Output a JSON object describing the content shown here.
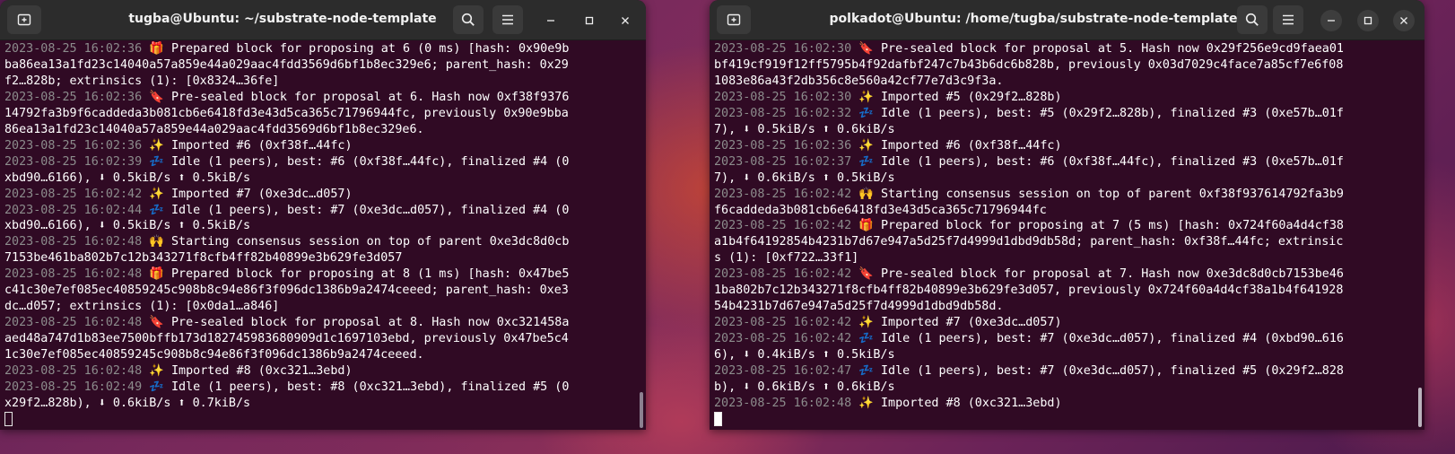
{
  "left_terminal": {
    "title": "tugba@Ubuntu: ~/substrate-node-template",
    "lines": [
      [
        {
          "t": "2023-08-25 16:02:36",
          "c": "ts"
        },
        {
          "t": " 🎁 Prepared block for proposing at 6 (0 ms) [hash: 0x90e9b"
        }
      ],
      [
        {
          "t": "ba86ea13a1fd23c14040a57a859e44a029aac4fdd3569d6bf1b8ec329e6; parent_hash: 0x29"
        }
      ],
      [
        {
          "t": "f2…828b; extrinsics (1): [0x8324…36fe]"
        }
      ],
      [
        {
          "t": "2023-08-25 16:02:36",
          "c": "ts"
        },
        {
          "t": " 🔖 Pre-sealed block for proposal at 6. Hash now 0xf38f9376"
        }
      ],
      [
        {
          "t": "14792fa3b9f6caddeda3b081cb6e6418fd3e43d5ca365c71796944fc, previously 0x90e9bba"
        }
      ],
      [
        {
          "t": "86ea13a1fd23c14040a57a859e44a029aac4fdd3569d6bf1b8ec329e6."
        }
      ],
      [
        {
          "t": "2023-08-25 16:02:36",
          "c": "ts"
        },
        {
          "t": " ✨ Imported #6 (0xf38f…44fc)"
        }
      ],
      [
        {
          "t": "2023-08-25 16:02:39",
          "c": "ts"
        },
        {
          "t": " 💤 Idle (1 peers), best: #6 (0xf38f…44fc), finalized #4 (0"
        }
      ],
      [
        {
          "t": "xbd90…6166), ⬇ 0.5kiB/s ⬆ 0.5kiB/s"
        }
      ],
      [
        {
          "t": "2023-08-25 16:02:42",
          "c": "ts"
        },
        {
          "t": " ✨ Imported #7 (0xe3dc…d057)"
        }
      ],
      [
        {
          "t": "2023-08-25 16:02:44",
          "c": "ts"
        },
        {
          "t": " 💤 Idle (1 peers), best: #7 (0xe3dc…d057), finalized #4 (0"
        }
      ],
      [
        {
          "t": "xbd90…6166), ⬇ 0.5kiB/s ⬆ 0.5kiB/s"
        }
      ],
      [
        {
          "t": "2023-08-25 16:02:48",
          "c": "ts"
        },
        {
          "t": " 🙌 Starting consensus session on top of parent 0xe3dc8d0cb"
        }
      ],
      [
        {
          "t": "7153be461ba802b7c12b343271f8cfb4ff82b40899e3b629fe3d057"
        }
      ],
      [
        {
          "t": "2023-08-25 16:02:48",
          "c": "ts"
        },
        {
          "t": " 🎁 Prepared block for proposing at 8 (1 ms) [hash: 0x47be5"
        }
      ],
      [
        {
          "t": "c41c30e7ef085ec40859245c908b8c94e86f3f096dc1386b9a2474ceeed; parent_hash: 0xe3"
        }
      ],
      [
        {
          "t": "dc…d057; extrinsics (1): [0x0da1…a846]"
        }
      ],
      [
        {
          "t": "2023-08-25 16:02:48",
          "c": "ts"
        },
        {
          "t": " 🔖 Pre-sealed block for proposal at 8. Hash now 0xc321458a"
        }
      ],
      [
        {
          "t": "aed48a747d1b83ee7500bffb173d182745983680909d1c1697103ebd, previously 0x47be5c4"
        }
      ],
      [
        {
          "t": "1c30e7ef085ec40859245c908b8c94e86f3f096dc1386b9a2474ceeed."
        }
      ],
      [
        {
          "t": "2023-08-25 16:02:48",
          "c": "ts"
        },
        {
          "t": " ✨ Imported #8 (0xc321…3ebd)"
        }
      ],
      [
        {
          "t": "2023-08-25 16:02:49",
          "c": "ts"
        },
        {
          "t": " 💤 Idle (1 peers), best: #8 (0xc321…3ebd), finalized #5 (0"
        }
      ],
      [
        {
          "t": "x29f2…828b), ⬇ 0.6kiB/s ⬆ 0.7kiB/s"
        }
      ]
    ]
  },
  "right_terminal": {
    "title": "polkadot@Ubuntu: /home/tugba/substrate-node-template",
    "lines": [
      [
        {
          "t": "2023-08-25 16:02:30",
          "c": "ts"
        },
        {
          "t": " 🔖 Pre-sealed block for proposal at 5. Hash now 0x29f256e9cd9faea01"
        }
      ],
      [
        {
          "t": "bf419cf919f12ff5795b4f92dafbf247c7b43b6dc6b828b, previously 0x03d7029c4face7a85cf7e6f08"
        }
      ],
      [
        {
          "t": "1083e86a43f2db356c8e560a42cf77e7d3c9f3a."
        }
      ],
      [
        {
          "t": "2023-08-25 16:02:30",
          "c": "ts"
        },
        {
          "t": " ✨ Imported #5 (0x29f2…828b)"
        }
      ],
      [
        {
          "t": "2023-08-25 16:02:32",
          "c": "ts"
        },
        {
          "t": " 💤 Idle (1 peers), best: #5 (0x29f2…828b), finalized #3 (0xe57b…01f"
        }
      ],
      [
        {
          "t": "7), ⬇ 0.5kiB/s ⬆ 0.6kiB/s"
        }
      ],
      [
        {
          "t": "2023-08-25 16:02:36",
          "c": "ts"
        },
        {
          "t": " ✨ Imported #6 (0xf38f…44fc)"
        }
      ],
      [
        {
          "t": "2023-08-25 16:02:37",
          "c": "ts"
        },
        {
          "t": " 💤 Idle (1 peers), best: #6 (0xf38f…44fc), finalized #3 (0xe57b…01f"
        }
      ],
      [
        {
          "t": "7), ⬇ 0.6kiB/s ⬆ 0.5kiB/s"
        }
      ],
      [
        {
          "t": "2023-08-25 16:02:42",
          "c": "ts"
        },
        {
          "t": " 🙌 Starting consensus session on top of parent 0xf38f937614792fa3b9"
        }
      ],
      [
        {
          "t": "f6caddeda3b081cb6e6418fd3e43d5ca365c71796944fc"
        }
      ],
      [
        {
          "t": "2023-08-25 16:02:42",
          "c": "ts"
        },
        {
          "t": " 🎁 Prepared block for proposing at 7 (5 ms) [hash: 0x724f60a4d4cf38"
        }
      ],
      [
        {
          "t": "a1b4f64192854b4231b7d67e947a5d25f7d4999d1dbd9db58d; parent_hash: 0xf38f…44fc; extrinsic"
        }
      ],
      [
        {
          "t": "s (1): [0xf722…33f1]"
        }
      ],
      [
        {
          "t": "2023-08-25 16:02:42",
          "c": "ts"
        },
        {
          "t": " 🔖 Pre-sealed block for proposal at 7. Hash now 0xe3dc8d0cb7153be46"
        }
      ],
      [
        {
          "t": "1ba802b7c12b343271f8cfb4ff82b40899e3b629fe3d057, previously 0x724f60a4d4cf38a1b4f641928"
        }
      ],
      [
        {
          "t": "54b4231b7d67e947a5d25f7d4999d1dbd9db58d."
        }
      ],
      [
        {
          "t": "2023-08-25 16:02:42",
          "c": "ts"
        },
        {
          "t": " ✨ Imported #7 (0xe3dc…d057)"
        }
      ],
      [
        {
          "t": "2023-08-25 16:02:42",
          "c": "ts"
        },
        {
          "t": " 💤 Idle (1 peers), best: #7 (0xe3dc…d057), finalized #4 (0xbd90…616"
        }
      ],
      [
        {
          "t": "6), ⬇ 0.4kiB/s ⬆ 0.5kiB/s"
        }
      ],
      [
        {
          "t": "2023-08-25 16:02:47",
          "c": "ts"
        },
        {
          "t": " 💤 Idle (1 peers), best: #7 (0xe3dc…d057), finalized #5 (0x29f2…828"
        }
      ],
      [
        {
          "t": "b), ⬇ 0.6kiB/s ⬆ 0.6kiB/s"
        }
      ],
      [
        {
          "t": "2023-08-25 16:02:48",
          "c": "ts"
        },
        {
          "t": " ✨ Imported #8 (0xc321…3ebd)"
        }
      ]
    ]
  },
  "colors": {
    "terminal_bg": "#300a24",
    "titlebar_bg": "#2c2c2c",
    "timestamp": "#8c8c8c",
    "text": "#ffffff"
  },
  "icons": {
    "new_tab": "new-tab-icon",
    "search": "search-icon",
    "menu": "hamburger-menu-icon",
    "minimize": "minimize-icon",
    "maximize": "maximize-icon",
    "close": "close-icon"
  }
}
